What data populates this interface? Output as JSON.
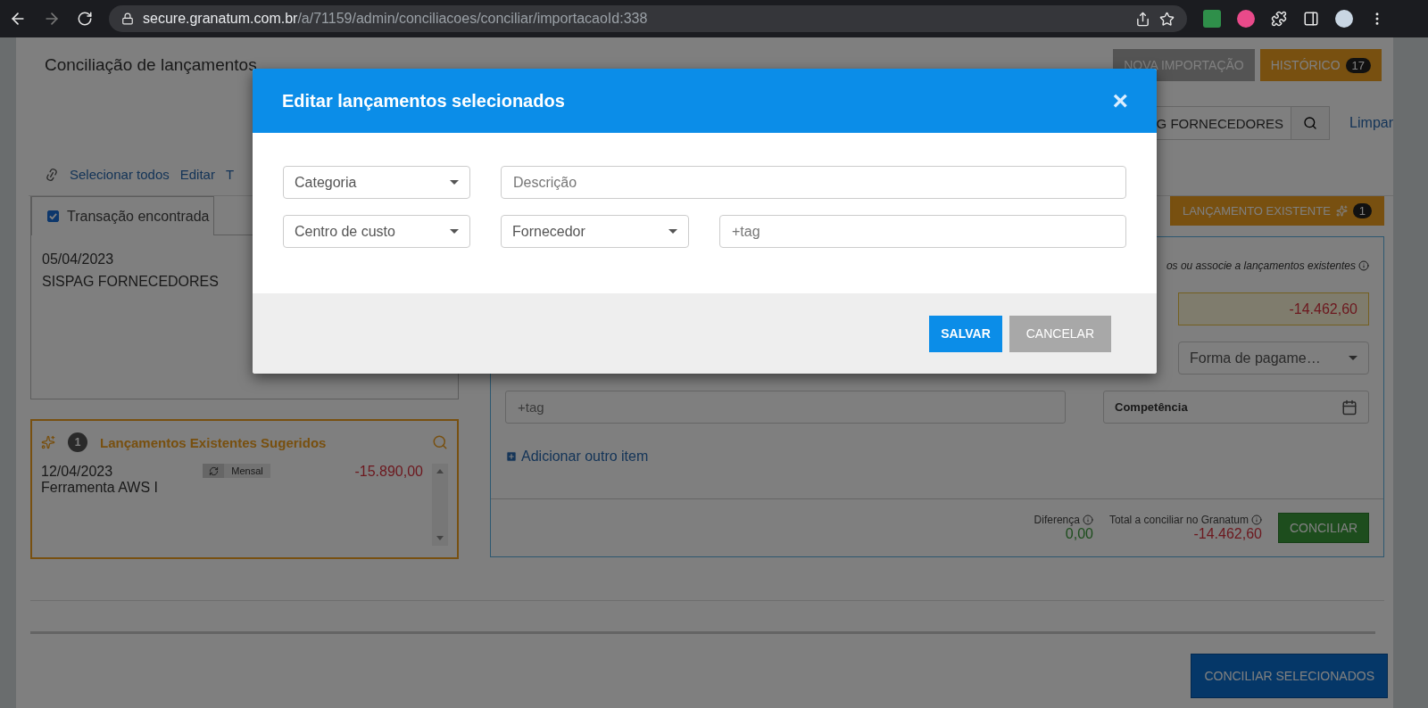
{
  "browser": {
    "url_domain": "secure.granatum.com.br",
    "url_path": "/a/71159/admin/conciliacoes/conciliar/importacaoId:338"
  },
  "header": {
    "title": "Conciliação de lançamentos",
    "buttons": [
      {
        "label": "NOVA IMPORTAÇÃO",
        "kind": "grey"
      },
      {
        "label": "HISTÓRICO",
        "kind": "orange",
        "count": "17"
      }
    ]
  },
  "filter": {
    "search_value": "G FORNECEDORES",
    "clear_link": "Limpar"
  },
  "toolbar": {
    "links": [
      "Selecionar todos",
      "Editar",
      "T"
    ]
  },
  "transaction_card": {
    "tab": {
      "label": "Transação encontrada",
      "checked": true
    },
    "date": "05/04/2023",
    "description": "SISPAG FORNECEDORES"
  },
  "suggestions": {
    "count": "1",
    "title": "Lançamentos Existentes Sugeridos",
    "items": [
      {
        "date": "12/04/2023",
        "name": "Ferramenta AWS I",
        "recurrence": "Mensal",
        "amount": "-15.890,00"
      }
    ]
  },
  "right_panel": {
    "existing_button": {
      "label": "LANÇAMENTO EXISTENTE",
      "count": "1"
    },
    "hint": "os ou associe a lançamentos existentes",
    "amount": "-14.462,60",
    "payment_select": "Forma de pagame…",
    "tag_placeholder": "+tag",
    "competencia": "Competência",
    "add_item_link": "Adicionar outro item",
    "difference": {
      "label": "Diferença",
      "value": "0,00"
    },
    "total": {
      "label": "Total a conciliar no Granatum",
      "value": "-14.462,60"
    },
    "conciliar_button": "CONCILIAR"
  },
  "bottom": {
    "button": "CONCILIAR SELECIONADOS"
  },
  "modal": {
    "title": "Editar lançamentos selecionados",
    "close": "×",
    "rows": [
      [
        {
          "kind": "select",
          "placeholder": "Categoria"
        },
        {
          "kind": "input",
          "placeholder": "Descrição"
        }
      ],
      [
        {
          "kind": "select",
          "placeholder": "Centro de custo"
        },
        {
          "kind": "select",
          "placeholder": "Fornecedor"
        },
        {
          "kind": "input",
          "placeholder": "+tag"
        }
      ]
    ],
    "buttons": [
      {
        "label": "SALVAR",
        "kind": "primary"
      },
      {
        "label": "CANCELAR",
        "kind": "secondary"
      }
    ]
  }
}
